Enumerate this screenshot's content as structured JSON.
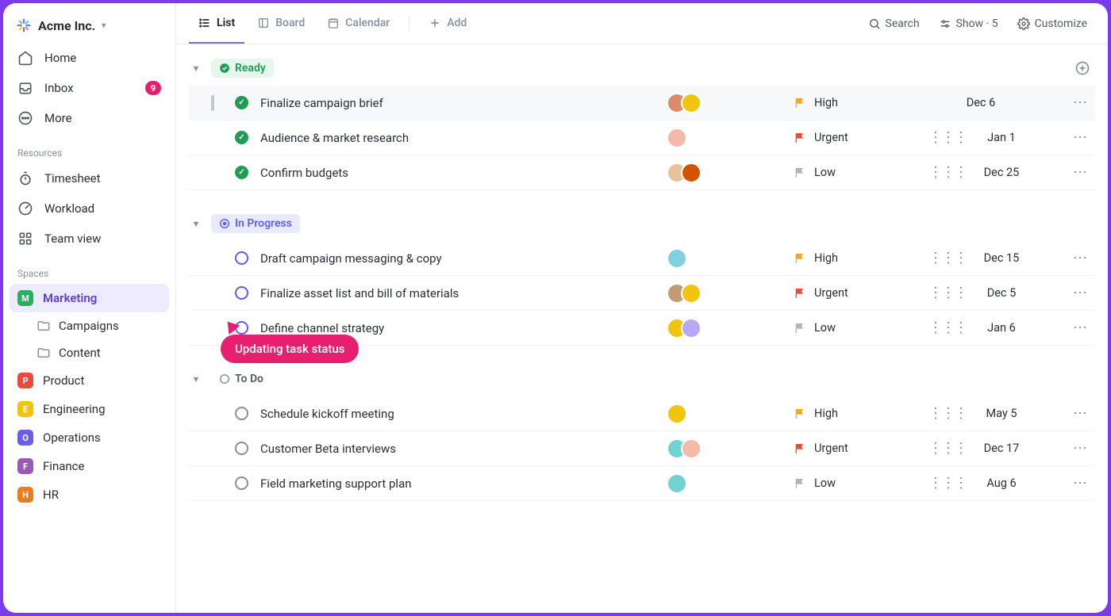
{
  "workspace": {
    "name": "Acme Inc."
  },
  "sidebar": {
    "nav": {
      "home": "Home",
      "inbox": "Inbox",
      "inbox_badge": "9",
      "more": "More"
    },
    "resources_label": "Resources",
    "resources": {
      "timesheet": "Timesheet",
      "workload": "Workload",
      "teamview": "Team view"
    },
    "spaces_label": "Spaces",
    "spaces": [
      {
        "letter": "M",
        "name": "Marketing",
        "color": "#27ae60",
        "active": true,
        "folders": [
          "Campaigns",
          "Content"
        ]
      },
      {
        "letter": "P",
        "name": "Product",
        "color": "#e74c3c"
      },
      {
        "letter": "E",
        "name": "Engineering",
        "color": "#f1c40f"
      },
      {
        "letter": "O",
        "name": "Operations",
        "color": "#6c5ce7"
      },
      {
        "letter": "F",
        "name": "Finance",
        "color": "#9b59b6"
      },
      {
        "letter": "H",
        "name": "HR",
        "color": "#e67e22"
      }
    ]
  },
  "toolbar": {
    "views": {
      "list": "List",
      "board": "Board",
      "calendar": "Calendar",
      "add": "Add"
    },
    "search": "Search",
    "show": "Show",
    "show_count": "5",
    "customize": "Customize"
  },
  "groups": [
    {
      "id": "ready",
      "label": "Ready",
      "pill_class": "ready",
      "status_dot": "check",
      "tasks": [
        {
          "name": "Finalize campaign brief",
          "status": "done",
          "avatars": [
            "#d98b6a",
            "#f1c40f"
          ],
          "prio": "High",
          "prio_color": "#f5a623",
          "date": "Dec 6",
          "drag": false,
          "hover": true,
          "checkbox": true
        },
        {
          "name": "Audience & market research",
          "status": "done",
          "avatars": [
            "#f4b9a7"
          ],
          "prio": "Urgent",
          "prio_color": "#e74c3c",
          "date": "Jan 1",
          "drag": true
        },
        {
          "name": "Confirm budgets",
          "status": "done",
          "avatars": [
            "#e8c39a",
            "#d35400"
          ],
          "prio": "Low",
          "prio_color": "#b0b5bd",
          "date": "Dec 25",
          "drag": true
        }
      ]
    },
    {
      "id": "progress",
      "label": "In Progress",
      "pill_class": "progress",
      "status_dot": "target",
      "tasks": [
        {
          "name": "Draft campaign messaging & copy",
          "status": "open-blue",
          "avatars": [
            "#7fd1e0"
          ],
          "prio": "High",
          "prio_color": "#f5a623",
          "date": "Dec 15",
          "drag": true
        },
        {
          "name": "Finalize asset list and bill of materials",
          "status": "open-blue",
          "avatars": [
            "#c39b77",
            "#f1c40f"
          ],
          "prio": "Urgent",
          "prio_color": "#e74c3c",
          "date": "Dec 5",
          "drag": true
        },
        {
          "name": "Define channel strategy",
          "status": "open-blue",
          "avatars": [
            "#f1c40f",
            "#b7a7f5"
          ],
          "prio": "Low",
          "prio_color": "#b0b5bd",
          "date": "Jan 6",
          "drag": true
        }
      ]
    },
    {
      "id": "todo",
      "label": "To Do",
      "pill_class": "todo",
      "status_dot": "circle",
      "tasks": [
        {
          "name": "Schedule kickoff meeting",
          "status": "open-gray",
          "avatars": [
            "#f1c40f"
          ],
          "prio": "High",
          "prio_color": "#f5a623",
          "date": "May 5",
          "drag": true
        },
        {
          "name": "Customer Beta interviews",
          "status": "open-gray",
          "avatars": [
            "#6fd4d0",
            "#f4b9a7"
          ],
          "prio": "Urgent",
          "prio_color": "#e74c3c",
          "date": "Dec 17",
          "drag": true
        },
        {
          "name": "Field marketing support plan",
          "status": "open-gray",
          "avatars": [
            "#6fd4d0"
          ],
          "prio": "Low",
          "prio_color": "#b0b5bd",
          "date": "Aug 6",
          "drag": true
        }
      ]
    }
  ],
  "tooltip": "Updating task status"
}
